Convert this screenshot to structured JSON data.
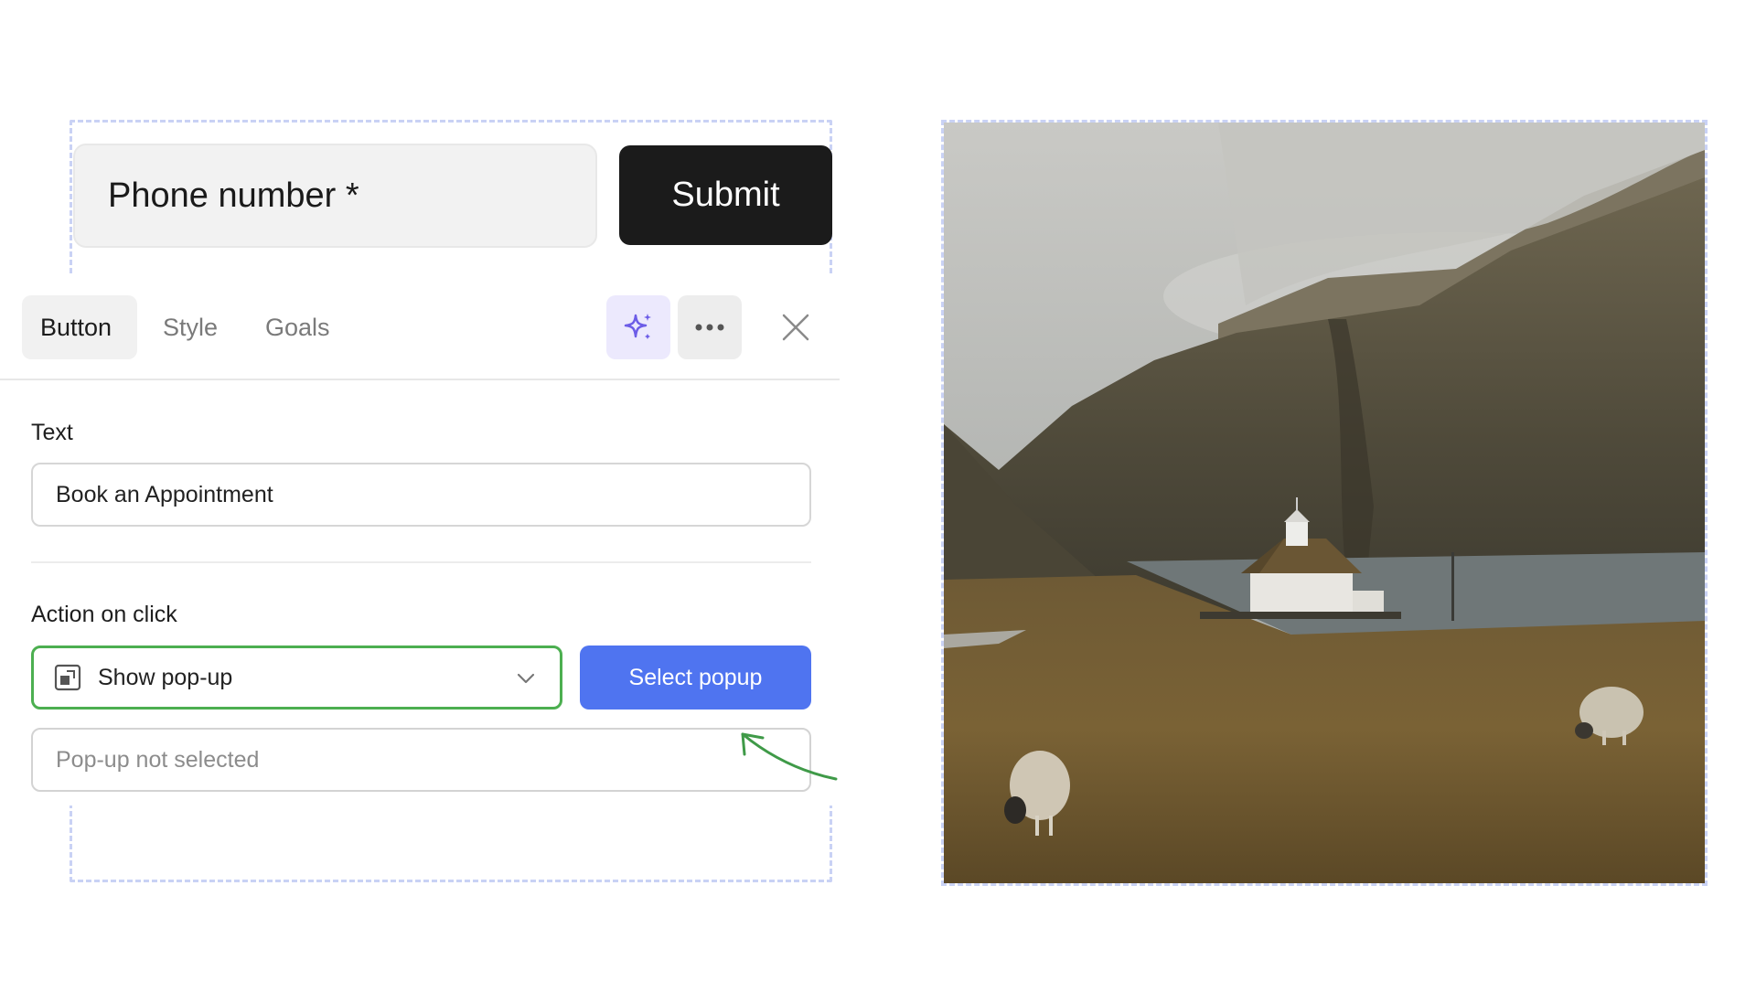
{
  "form": {
    "phone_placeholder": "Phone number *",
    "submit_label": "Submit"
  },
  "panel": {
    "tabs": [
      {
        "label": "Button",
        "active": true
      },
      {
        "label": "Style",
        "active": false
      },
      {
        "label": "Goals",
        "active": false
      }
    ],
    "icons": {
      "ai": "sparkle-icon",
      "more": "more-horizontal-icon",
      "close": "close-icon"
    },
    "text_section": {
      "label": "Text",
      "value": "Book an Appointment"
    },
    "action_section": {
      "label": "Action on click",
      "selected_action": "Show pop-up",
      "select_popup_label": "Select popup",
      "popup_placeholder": "Pop-up not selected"
    }
  },
  "colors": {
    "accent_blue": "#4f74f0",
    "select_border_green": "#4caf50",
    "submit_bg": "#1b1b1b",
    "ai_purple": "#6c5ce7"
  }
}
